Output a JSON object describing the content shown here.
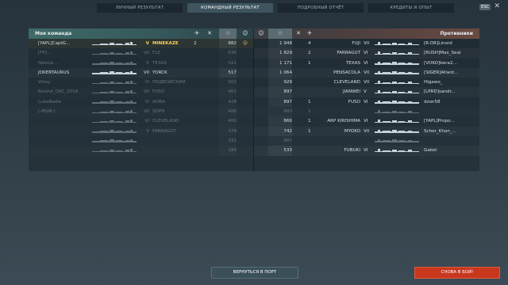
{
  "tabs": [
    "ЛИЧНЫЙ РЕЗУЛЬТАТ",
    "КОМАНДНЫЙ РЕЗУЛЬТАТ",
    "ПОДРОБНЫЙ ОТЧЁТ",
    "КРЕДИТЫ И ОПЫТ"
  ],
  "esc_label": "ESC",
  "close_glyph": "✕",
  "left": {
    "title": "Моя команда",
    "rows": [
      {
        "player": "[YAPL]CaptG...",
        "tier": "V",
        "ship": "MINEKAZE",
        "col1": "2",
        "star": "882",
        "me": true,
        "dead": false,
        "mark": "☺"
      },
      {
        "player": "[FP]...",
        "tier": "VII",
        "ship": "FLE",
        "col1": "",
        "star": "536",
        "me": false,
        "dead": true,
        "mark": ""
      },
      {
        "player": "Natsuk...",
        "tier": "V",
        "ship": "TEXAS",
        "col1": "",
        "star": "521",
        "me": false,
        "dead": true,
        "mark": ""
      },
      {
        "player": "JOKERTAURUS",
        "tier": "VII",
        "ship": "YORCK",
        "col1": "",
        "star": "517",
        "me": false,
        "dead": false,
        "mark": ""
      },
      {
        "player": "Vinoy",
        "tier": "VI",
        "ship": "ПОДВОЙСКИЙ",
        "col1": "",
        "star": "502",
        "me": false,
        "dead": true,
        "mark": ""
      },
      {
        "player": "Kevind_OIIC_2018",
        "tier": "VII",
        "ship": "FUSO",
        "col1": "",
        "star": "461",
        "me": false,
        "dead": true,
        "mark": ""
      },
      {
        "player": "LubaBadix",
        "tier": "VI",
        "ship": "AOBA",
        "col1": "",
        "star": "428",
        "me": false,
        "dead": true,
        "mark": ""
      },
      {
        "player": "[-MSM-]",
        "tier": "VII",
        "ship": "SOPH",
        "col1": "",
        "star": "406",
        "me": false,
        "dead": true,
        "mark": ""
      },
      {
        "player": "",
        "tier": "VI",
        "ship": "CLEVELAND",
        "col1": "",
        "star": "400",
        "me": false,
        "dead": true,
        "mark": ""
      },
      {
        "player": "",
        "tier": "V",
        "ship": "FARRAGUT",
        "col1": "",
        "star": "379",
        "me": false,
        "dead": true,
        "mark": ""
      },
      {
        "player": "",
        "tier": "",
        "ship": "",
        "col1": "",
        "star": "331",
        "me": false,
        "dead": true,
        "mark": ""
      },
      {
        "player": "",
        "tier": "",
        "ship": "",
        "col1": "",
        "star": "184",
        "me": false,
        "dead": true,
        "mark": ""
      }
    ]
  },
  "right": {
    "title": "Противники",
    "rows": [
      {
        "star": "1 948",
        "kills": "4",
        "ship": "FUJI",
        "tier": "VII",
        "player": "[R-DR]Linord",
        "dead": false
      },
      {
        "star": "1 829",
        "kills": "2",
        "ship": "FARRAGUT",
        "tier": "VI",
        "player": "[RUSH]Max_Seal",
        "dead": false
      },
      {
        "star": "1 171",
        "kills": "1",
        "ship": "TEXAS",
        "tier": "VI",
        "player": "[VOKO]bera2...",
        "dead": false
      },
      {
        "star": "1 064",
        "kills": "",
        "ship": "PENSACOLA",
        "tier": "VII",
        "player": "[SIGER]Atlant...",
        "dead": false
      },
      {
        "star": "929",
        "kills": "",
        "ship": "CLEVELAND",
        "tier": "VII",
        "player": "Higawo_",
        "dead": false
      },
      {
        "star": "897",
        "kills": "",
        "ship": "JIANWEI",
        "tier": "V",
        "player": "[LPRD]sandr...",
        "dead": false
      },
      {
        "star": "897",
        "kills": "1",
        "ship": "FUSO",
        "tier": "VI",
        "player": "dzon58",
        "dead": false
      },
      {
        "star": "883",
        "kills": "1",
        "ship": "",
        "tier": "",
        "player": "",
        "dead": true
      },
      {
        "star": "866",
        "kills": "1",
        "ship": "ARP KIRISHIMA",
        "tier": "VI",
        "player": "[YAPL]Propo...",
        "dead": false
      },
      {
        "star": "742",
        "kills": "1",
        "ship": "MYOKO",
        "tier": "VII",
        "player": "Scher_Khan_...",
        "dead": false
      },
      {
        "star": "687",
        "kills": "",
        "ship": "",
        "tier": "",
        "player": "",
        "dead": true
      },
      {
        "star": "533",
        "kills": "",
        "ship": "FUBUKI",
        "tier": "VI",
        "player": "Gaket",
        "dead": false
      }
    ]
  },
  "buttons": {
    "port": "ВЕРНУТЬСЯ В ПОРТ",
    "battle": "СНОВА В БОЙ!"
  }
}
